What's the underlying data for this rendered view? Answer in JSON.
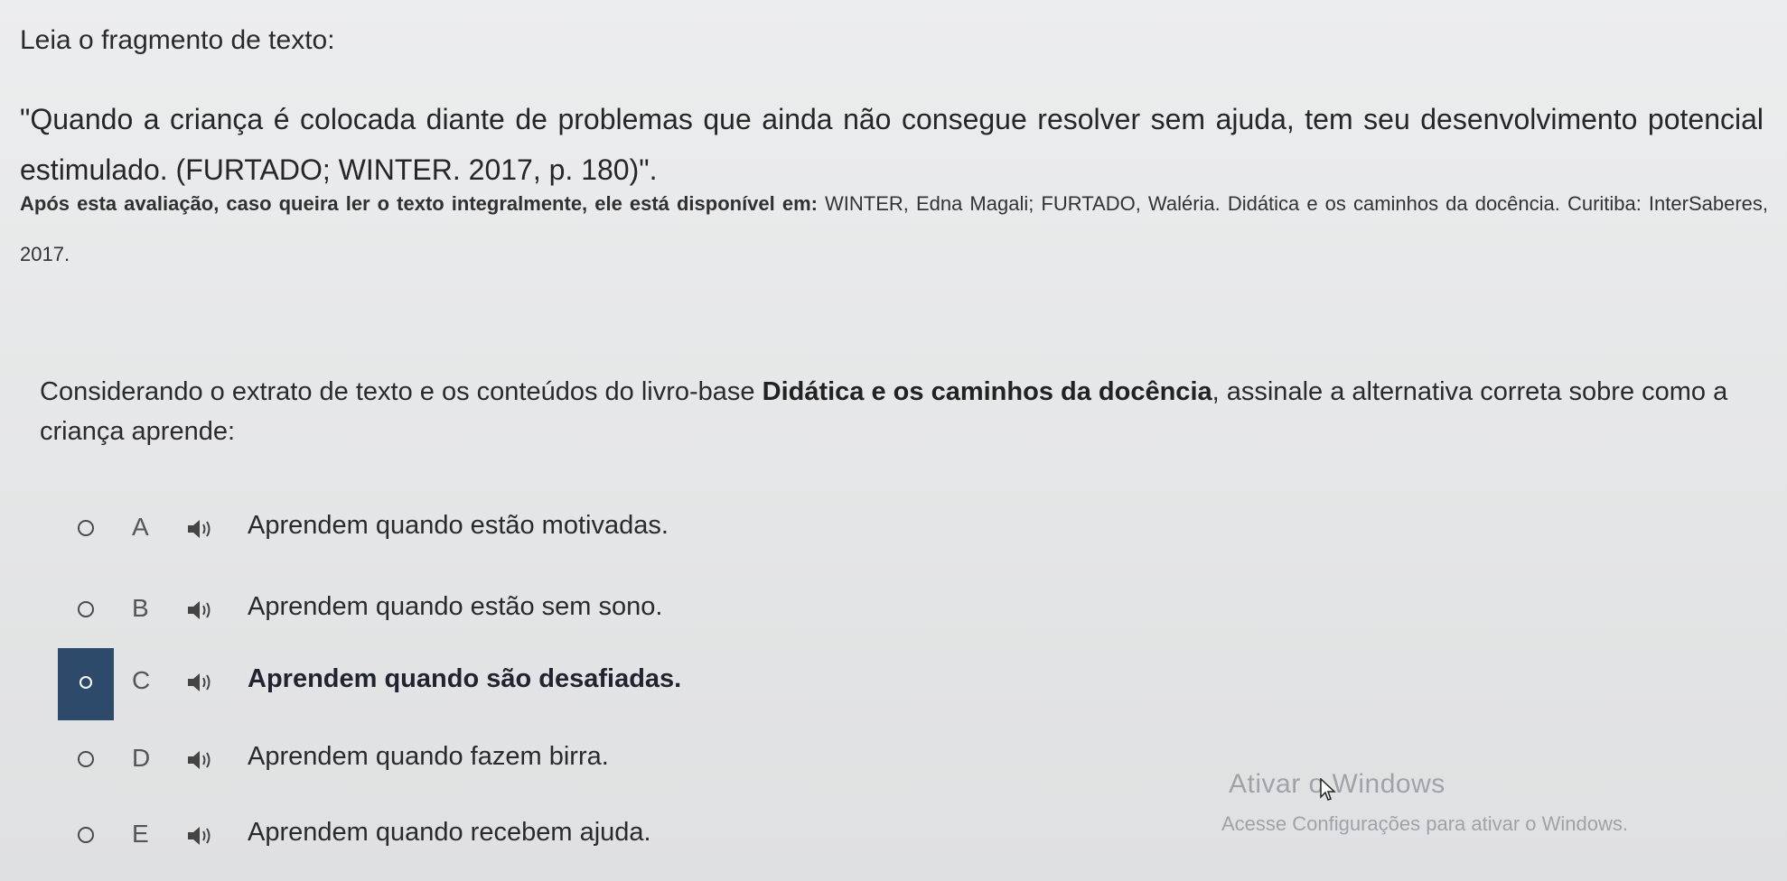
{
  "prompt": "Leia o fragmento de texto:",
  "quote": "\"Quando a criança é colocada diante de problemas que ainda não consegue resolver sem ajuda, tem seu desenvolvimento potencial estimulado. (FURTADO; WINTER. 2017, p. 180)\".",
  "source": {
    "lead": "Após esta avaliação, caso queira ler o texto integralmente, ele está disponível em:",
    "rest": "WINTER, Edna Magali; FURTADO, Waléria. Didática e os caminhos da docência. Curitiba: InterSaberes, 2017."
  },
  "question": {
    "before": "Considerando o extrato de texto e os conteúdos do livro-base ",
    "book": "Didática e os caminhos da docência",
    "after": ", assinale a alternativa correta sobre como a criança aprende:"
  },
  "options": [
    {
      "letter": "A",
      "text": "Aprendem quando estão motivadas.",
      "selected": false,
      "icon": "speaker-icon"
    },
    {
      "letter": "B",
      "text": "Aprendem quando estão sem sono.",
      "selected": false,
      "icon": "speaker-icon"
    },
    {
      "letter": "C",
      "text": "Aprendem quando são desafiadas.",
      "selected": true,
      "icon": "speaker-icon"
    },
    {
      "letter": "D",
      "text": "Aprendem quando fazem birra.",
      "selected": false,
      "icon": "speaker-icon"
    },
    {
      "letter": "E",
      "text": "Aprendem quando recebem ajuda.",
      "selected": false,
      "icon": "speaker-icon"
    }
  ],
  "watermark": {
    "title": "Ativar o Windows",
    "subtitle": "Acesse Configurações para ativar o Windows."
  },
  "colors": {
    "selected_bar": "#2d4a6a",
    "background": "#e6e7e8",
    "watermark": "#9ea3a8"
  }
}
